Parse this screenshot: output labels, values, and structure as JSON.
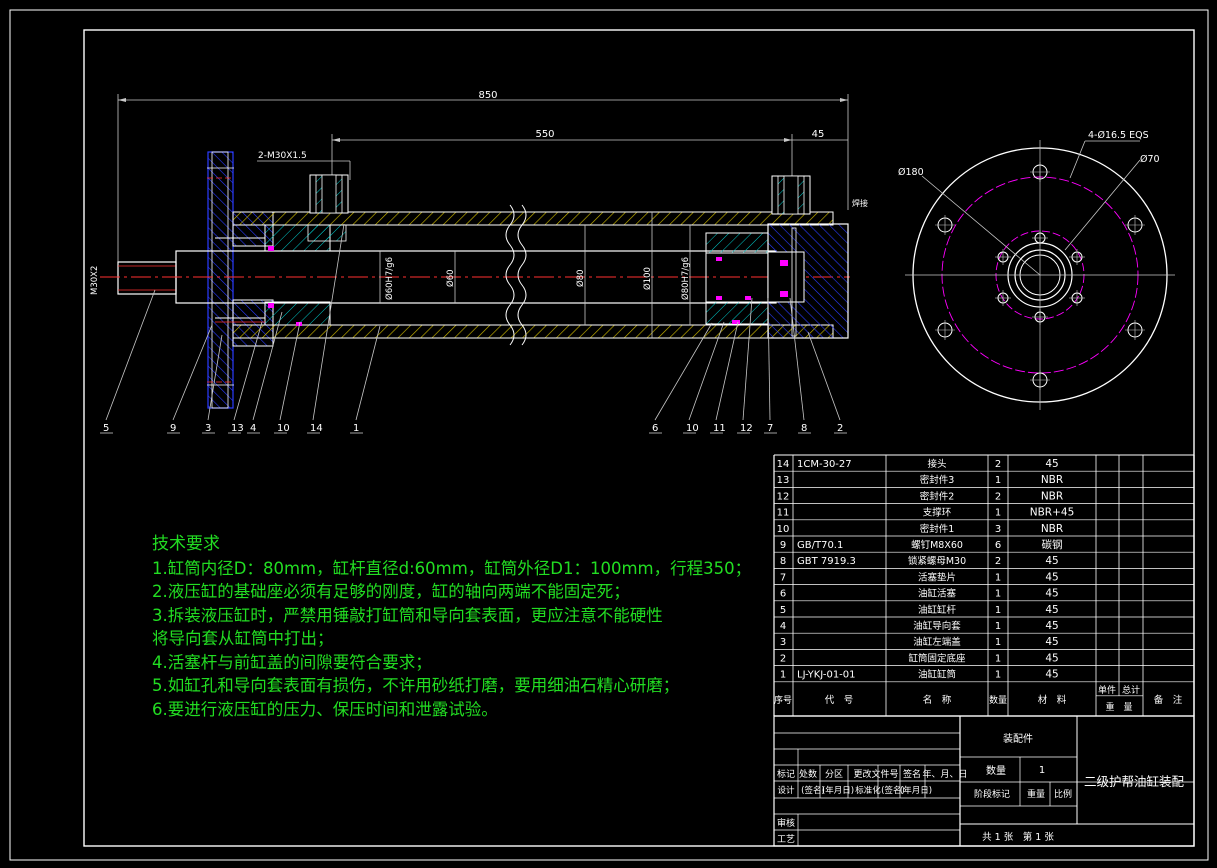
{
  "drawing": {
    "dimensions": {
      "overall_length": "850",
      "stroke_section": "550",
      "end_offset": "45",
      "port_thread": "2-M30X1.5",
      "rod_thread": "M30X2",
      "bore_fit": "Ø80H7/g6",
      "rod_fit": "Ø60H7/g6",
      "rod_dia": "Ø60",
      "bore_dia": "Ø80",
      "outer_dia": "Ø100",
      "weld_note": "焊接",
      "bolt_holes": "4-Ø16.5 EQS",
      "flange_dia": "Ø180",
      "pcd_dia": "Ø70"
    },
    "balloons": [
      "5",
      "9",
      "3",
      "13",
      "4",
      "10",
      "14",
      "1",
      "6",
      "10",
      "11",
      "12",
      "7",
      "8",
      "2"
    ],
    "colors": {
      "outline": "#ffffff",
      "hatch": "#00c8c8",
      "part_blue": "#2b3cff",
      "centerline": "#ff3030",
      "seal": "#ff00ff",
      "dimension": "#c8c8c8",
      "tech_text": "#22dd22",
      "border": "#ffffff"
    }
  },
  "tech_requirements": {
    "title": "技术要求",
    "items": [
      "1.缸筒内径D：80mm，缸杆直径d:60mm，缸筒外径D1：100mm，行程350；",
      "2.液压缸的基础座必须有足够的刚度，缸的轴向两端不能固定死；",
      "3.拆装液压缸时，严禁用锤敲打缸筒和导向套表面，更应注意不能硬性",
      "将导向套从缸筒中打出；",
      "4.活塞杆与前缸盖的间隙要符合要求；",
      "5.如缸孔和导向套表面有损伤，不许用砂纸打磨，要用细油石精心研磨；",
      "6.要进行液压缸的压力、保压时间和泄露试验。"
    ]
  },
  "bom": {
    "rows": [
      {
        "no": "14",
        "code": "1CM-30-27",
        "name": "接头",
        "qty": "2",
        "mat": "45"
      },
      {
        "no": "13",
        "code": "",
        "name": "密封件3",
        "qty": "1",
        "mat": "NBR"
      },
      {
        "no": "12",
        "code": "",
        "name": "密封件2",
        "qty": "2",
        "mat": "NBR"
      },
      {
        "no": "11",
        "code": "",
        "name": "支撑环",
        "qty": "1",
        "mat": "NBR+45"
      },
      {
        "no": "10",
        "code": "",
        "name": "密封件1",
        "qty": "3",
        "mat": "NBR"
      },
      {
        "no": "9",
        "code": "GB/T70.1",
        "name": "螺钉M8X60",
        "qty": "6",
        "mat": "碳钢"
      },
      {
        "no": "8",
        "code": "GBT 7919.3",
        "name": "锁紧螺母M30",
        "qty": "2",
        "mat": "45"
      },
      {
        "no": "7",
        "code": "",
        "name": "活塞垫片",
        "qty": "1",
        "mat": "45"
      },
      {
        "no": "6",
        "code": "",
        "name": "油缸活塞",
        "qty": "1",
        "mat": "45"
      },
      {
        "no": "5",
        "code": "",
        "name": "油缸缸杆",
        "qty": "1",
        "mat": "45"
      },
      {
        "no": "4",
        "code": "",
        "name": "油缸导向套",
        "qty": "1",
        "mat": "45"
      },
      {
        "no": "3",
        "code": "",
        "name": "油缸左端盖",
        "qty": "1",
        "mat": "45"
      },
      {
        "no": "2",
        "code": "",
        "name": "缸筒固定底座",
        "qty": "1",
        "mat": "45"
      },
      {
        "no": "1",
        "code": "LJ-YKJ-01-01",
        "name": "油缸缸筒",
        "qty": "1",
        "mat": "45"
      }
    ],
    "header": {
      "no": "序号",
      "code": "代　号",
      "name": "名　称",
      "qty": "数量",
      "mat": "材　料",
      "unit": "单件",
      "total": "总计",
      "weight": "重　量",
      "remark": "备　注"
    }
  },
  "title_block": {
    "assembly_label": "装配件",
    "qty_label": "数量",
    "qty_value": "1",
    "drawing_name": "二级护帮油缸装配",
    "row_mark": [
      "标记",
      "处数",
      "分区",
      "更改文件号",
      "签名",
      "年、月、日"
    ],
    "row_design": [
      "设计",
      "(签名)",
      "(年月日)",
      "标准化",
      "(签名)",
      "(年月日)"
    ],
    "stage_mark": "阶段标记",
    "weight": "重量",
    "scale": "比例",
    "review": "审核",
    "process": "工艺",
    "sheet_info": "共 1 张　第 1 张"
  }
}
